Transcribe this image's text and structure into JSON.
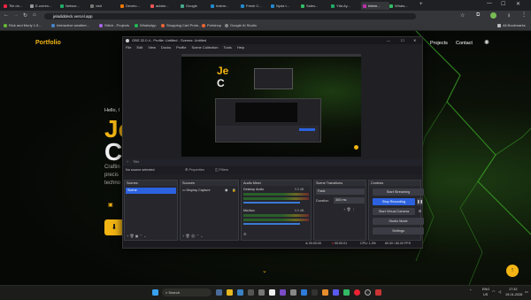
{
  "browser": {
    "tabs": [
      {
        "label": "Tile do..."
      },
      {
        "label": "E-comm..."
      },
      {
        "label": "Networ..."
      },
      {
        "label": "visit"
      },
      {
        "label": "Develo..."
      },
      {
        "label": "adobe..."
      },
      {
        "label": "Google"
      },
      {
        "label": "Instrm..."
      },
      {
        "label": "Fresh C..."
      },
      {
        "label": "Nyda t..."
      },
      {
        "label": "Sales..."
      },
      {
        "label": "Ytta Ay..."
      },
      {
        "label": "Intern..."
      },
      {
        "label": "Whats..."
      }
    ],
    "url": "jeladiddeck.vercel.app",
    "bookmarks": [
      {
        "label": "Rick and Morty 1.5..."
      },
      {
        "label": "Interactive weather..."
      },
      {
        "label": "Stitch - Projects"
      },
      {
        "label": "WhatsApp"
      },
      {
        "label": "Shopping Cart Proto..."
      },
      {
        "label": "Portshop"
      },
      {
        "label": "Google AI Studio"
      }
    ],
    "all_bookmarks": "All Bookmarks",
    "colors": {
      "accent": "#f3b514",
      "obs_blue": "#2c62e0"
    }
  },
  "site": {
    "logo": "Portfolio",
    "nav": {
      "projects": "Projects",
      "contact": "Contact"
    },
    "hello": "Hello, I",
    "headline1": "Je",
    "headline2": "C",
    "lines": [
      "Craftin",
      "precis",
      "techno"
    ],
    "cta": "⬇"
  },
  "obs": {
    "title": "OBS 32.0.4 - Profile: Untitled - Scenes: Untitled",
    "menu": [
      "File",
      "Edit",
      "View",
      "Docks",
      "Profile",
      "Scene Collection",
      "Tools",
      "Help"
    ],
    "status_small": "Title",
    "no_source": "No source selected",
    "properties": "Properties",
    "filters": "Filters",
    "docks": {
      "scenes": {
        "title": "Scenes",
        "items": [
          "Scene"
        ]
      },
      "sources": {
        "title": "Sources",
        "items": [
          "Display Capture"
        ]
      },
      "audio": {
        "title": "Audio Mixer",
        "desktop": "Desktop Audio",
        "mic": "Mic/Aux",
        "db1": "0.0 dB",
        "db2": "0.0 dB"
      },
      "transitions": {
        "title": "Scene Transitions",
        "type": "Fade",
        "duration_label": "Duration",
        "duration": "300 ms"
      },
      "controls": {
        "title": "Controls",
        "buttons": [
          "Start Streaming",
          "Stop Recording",
          "Start Virtual Camera",
          "Studio Mode",
          "Settings"
        ]
      }
    },
    "status": {
      "rec_time": "00:00:01",
      "stream_time": "00:00:00",
      "cpu": "CPU: 1.3%",
      "fps": "60.00 / 60.00 FPS"
    }
  },
  "taskbar": {
    "search": "Search",
    "lang1": "ENG",
    "lang2": "US",
    "time": "17:32",
    "date": "19-01-2026"
  }
}
